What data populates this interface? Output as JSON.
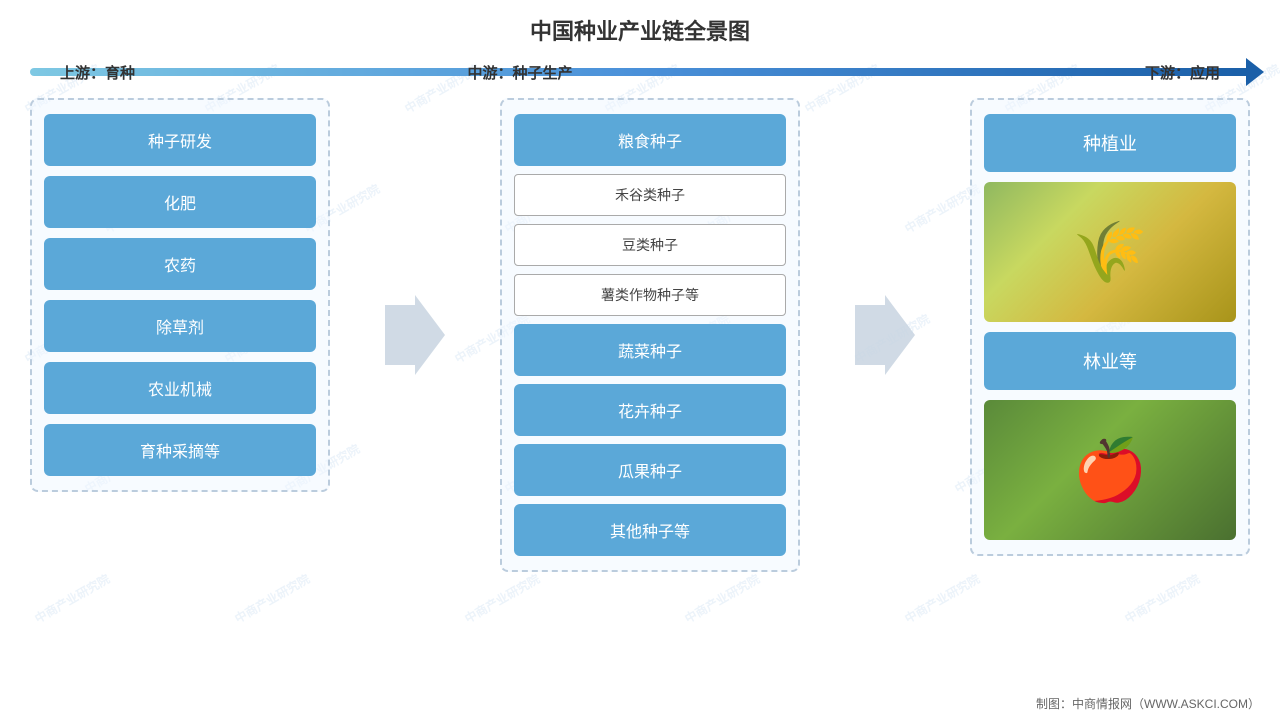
{
  "title": "中国种业产业链全景图",
  "arrowLabels": {
    "upstream": "上游：育种",
    "midstream": "中游：种子生产",
    "downstream": "下游：应用"
  },
  "leftColumn": {
    "items": [
      "种子研发",
      "化肥",
      "农药",
      "除草剂",
      "农业机械",
      "育种采摘等"
    ]
  },
  "middleColumn": {
    "blueItems": [
      "粮食种子",
      "蔬菜种子",
      "花卉种子",
      "瓜果种子",
      "其他种子等"
    ],
    "outlineItems": [
      "禾谷类种子",
      "豆类种子",
      "薯类作物种子等"
    ]
  },
  "rightColumn": {
    "items": [
      "种植业",
      "林业等"
    ]
  },
  "footer": "制图：中商情报网（WWW.ASKCI.COM）",
  "watermarkText": "中商产业研究院"
}
